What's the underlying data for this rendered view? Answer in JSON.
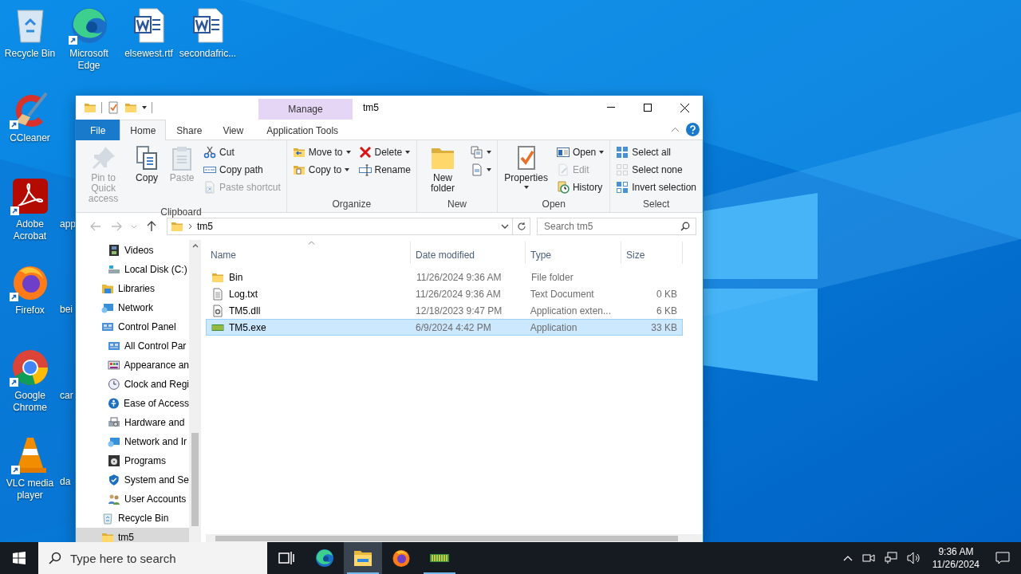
{
  "desktop": {
    "icons": [
      {
        "label": "Recycle Bin",
        "shortcut": false
      },
      {
        "label": "Microsoft Edge",
        "shortcut": true
      },
      {
        "label": "elsewest.rtf",
        "shortcut": false
      },
      {
        "label": "secondafric...",
        "shortcut": false
      },
      {
        "label": "CCleaner",
        "shortcut": true
      },
      {
        "label": "Adobe Acrobat",
        "shortcut": true
      },
      {
        "label": "Firefox",
        "shortcut": true
      },
      {
        "label": "Google Chrome",
        "shortcut": true
      },
      {
        "label": "VLC media player",
        "shortcut": true
      }
    ],
    "partial_labels": [
      "app",
      "bei",
      "car",
      "da"
    ]
  },
  "window": {
    "title": "tm5",
    "contextual_header": "Manage",
    "tabs": [
      {
        "label": "File",
        "kind": "file",
        "selected": false
      },
      {
        "label": "Home",
        "kind": "normal",
        "selected": true
      },
      {
        "label": "Share",
        "kind": "normal",
        "selected": false
      },
      {
        "label": "View",
        "kind": "normal",
        "selected": false
      },
      {
        "label": "Application Tools",
        "kind": "contextual",
        "selected": false
      }
    ],
    "ribbon": {
      "groups": [
        {
          "label": "Clipboard",
          "columns": [
            {
              "kind": "large",
              "commands": [
                {
                  "label": "Pin to Quick access",
                  "disabled": true
                }
              ]
            },
            {
              "kind": "large",
              "commands": [
                {
                  "label": "Copy",
                  "disabled": false
                }
              ]
            },
            {
              "kind": "large",
              "commands": [
                {
                  "label": "Paste",
                  "disabled": true
                }
              ]
            },
            {
              "kind": "small",
              "commands": [
                {
                  "label": "Cut",
                  "disabled": false
                },
                {
                  "label": "Copy path",
                  "disabled": false
                },
                {
                  "label": "Paste shortcut",
                  "disabled": true
                }
              ]
            }
          ]
        },
        {
          "label": "Organize",
          "columns": [
            {
              "kind": "small",
              "commands": [
                {
                  "label": "Move to",
                  "disabled": false,
                  "dropdown": true
                },
                {
                  "label": "Copy to",
                  "disabled": false,
                  "dropdown": true
                }
              ]
            },
            {
              "kind": "small",
              "commands": [
                {
                  "label": "Delete",
                  "disabled": false,
                  "dropdown": true
                },
                {
                  "label": "Rename",
                  "disabled": false
                }
              ]
            }
          ]
        },
        {
          "label": "New",
          "columns": [
            {
              "kind": "large",
              "commands": [
                {
                  "label": "New folder",
                  "disabled": false
                }
              ]
            },
            {
              "kind": "small",
              "commands": [
                {
                  "disabled": false,
                  "dropdown": true
                },
                {
                  "disabled": false,
                  "dropdown": true
                }
              ]
            }
          ]
        },
        {
          "label": "Open",
          "columns": [
            {
              "kind": "large",
              "commands": [
                {
                  "label": "Properties",
                  "disabled": false,
                  "dropdown": true
                }
              ]
            },
            {
              "kind": "small",
              "commands": [
                {
                  "label": "Open",
                  "disabled": false,
                  "dropdown": true
                },
                {
                  "label": "Edit",
                  "disabled": true
                },
                {
                  "label": "History",
                  "disabled": false
                }
              ]
            }
          ]
        },
        {
          "label": "Select",
          "columns": [
            {
              "kind": "small",
              "commands": [
                {
                  "label": "Select all",
                  "disabled": false
                },
                {
                  "label": "Select none",
                  "disabled": false
                },
                {
                  "label": "Invert selection",
                  "disabled": false
                }
              ]
            }
          ]
        }
      ]
    },
    "address_bar": {
      "path": [
        "tm5"
      ]
    },
    "search": {
      "placeholder": "Search tm5"
    },
    "nav_pane": {
      "continued_items": [
        {
          "label": "Videos",
          "selected": false
        },
        {
          "label": "Local Disk (C:)",
          "selected": false
        }
      ],
      "items": [
        {
          "label": "Libraries",
          "selected": false
        },
        {
          "label": "Network",
          "selected": false
        },
        {
          "label": "Control Panel",
          "selected": false,
          "children": [
            {
              "label": "All Control Par",
              "selected": false
            },
            {
              "label": "Appearance an",
              "selected": false
            },
            {
              "label": "Clock and Regi",
              "selected": false
            },
            {
              "label": "Ease of Access",
              "selected": false
            },
            {
              "label": "Hardware and",
              "selected": false
            },
            {
              "label": "Network and Ir",
              "selected": false
            },
            {
              "label": "Programs",
              "selected": false
            },
            {
              "label": "System and Se",
              "selected": false
            },
            {
              "label": "User Accounts",
              "selected": false
            }
          ]
        },
        {
          "label": "Recycle Bin",
          "selected": false
        },
        {
          "label": "tm5",
          "selected": true
        }
      ]
    },
    "files": {
      "columns": [
        {
          "label": "Name",
          "sorted": true
        },
        {
          "label": "Date modified",
          "sorted": false
        },
        {
          "label": "Type",
          "sorted": false
        },
        {
          "label": "Size",
          "sorted": false
        }
      ],
      "rows": [
        {
          "kind": "folder",
          "name": "Bin",
          "date": "11/26/2024 9:36 AM",
          "type": "File folder",
          "selected": false
        },
        {
          "kind": "text",
          "name": "Log.txt",
          "date": "11/26/2024 9:36 AM",
          "type": "Text Document",
          "size": "0 KB",
          "selected": false
        },
        {
          "kind": "library",
          "name": "TM5.dll",
          "date": "12/18/2023 9:47 PM",
          "type": "Application exten...",
          "size": "6 KB",
          "selected": false
        },
        {
          "kind": "program",
          "name": "TM5.exe",
          "date": "6/9/2024 4:42 PM",
          "type": "Application",
          "size": "33 KB",
          "selected": true
        }
      ]
    }
  },
  "taskbar": {
    "search_placeholder": "Type here to search",
    "apps": [
      {
        "kind": "task_view",
        "active": false,
        "running": false
      },
      {
        "kind": "edge",
        "active": false,
        "running": false
      },
      {
        "kind": "explorer",
        "active": true,
        "running": true
      },
      {
        "kind": "firefox",
        "active": false,
        "running": false
      },
      {
        "kind": "program",
        "active": false,
        "running": true
      }
    ],
    "time": "9:36 AM",
    "date": "11/26/2024"
  }
}
